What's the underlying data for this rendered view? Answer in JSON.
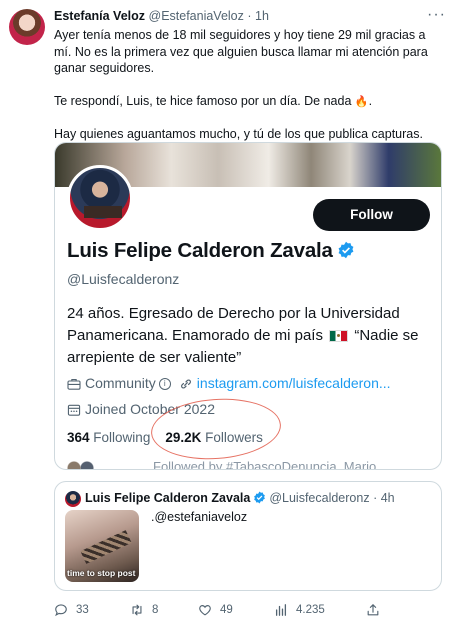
{
  "tweet": {
    "author_name": "Estefanía Veloz",
    "author_handle": "@EstefaniaVeloz",
    "separator": "·",
    "time": "1h",
    "paragraphs": [
      "Ayer tenía menos de 18 mil seguidores y hoy tiene 29 mil gracias a mí. No es la primera vez que alguien busca llamar mi atención para ganar seguidores.",
      "Te respondí, Luis, te hice famoso por un día. De nada",
      "Hay quienes aguantamos mucho, y tú de los que publica capturas."
    ]
  },
  "profile_card": {
    "follow_label": "Follow",
    "name": "Luis Felipe Calderon Zavala",
    "handle": "@Luisfecalderonz",
    "bio_before_flag": "24 años. Egresado de Derecho por la Universidad Panamericana. Enamorado de mi país",
    "bio_after_flag": "“Nadie se arrepiente de ser valiente”",
    "category": "Community",
    "link": "instagram.com/luisfecalderon...",
    "joined": "Joined October 2022",
    "following_count": "364",
    "following_label": "Following",
    "followers_count": "29.2K",
    "followers_label": "Followers",
    "followed_by": "Followed by #TabascoDenuncia, Mario"
  },
  "quoted_tweet": {
    "author_name": "Luis Felipe Calderon Zavala",
    "author_handle": "@Luisfecalderonz",
    "separator": "·",
    "time": "4h",
    "text": ".@estefaniaveloz",
    "thumb_caption": "time to stop post"
  },
  "actions": {
    "replies": "33",
    "retweets": "8",
    "likes": "49",
    "views": "4.235"
  },
  "colors": {
    "accent": "#1d9bf0",
    "text": "#0f1419",
    "secondary": "#536471",
    "annotation": "#e0503e"
  }
}
